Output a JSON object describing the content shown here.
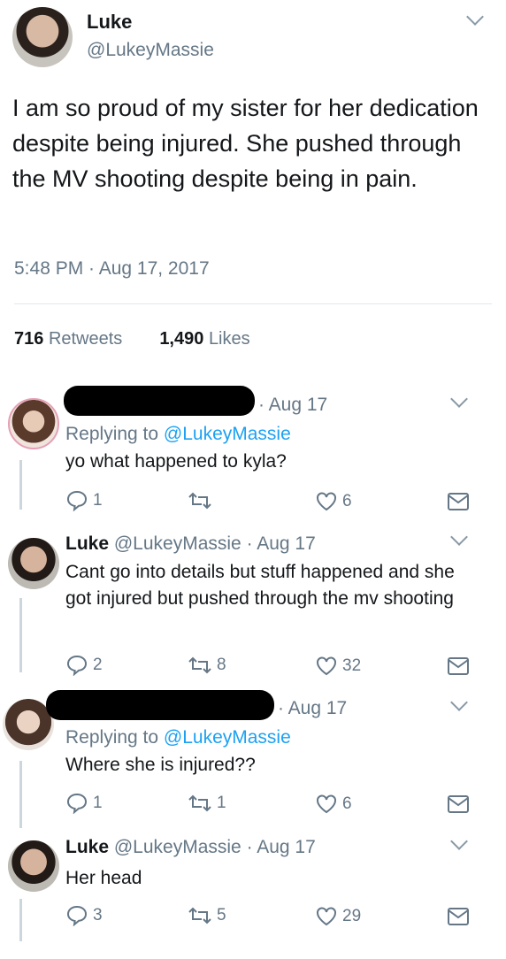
{
  "main_tweet": {
    "author_name": "Luke",
    "author_handle": "@LukeyMassie",
    "text": "I am so proud of my sister for her dedication despite being injured. She pushed through the MV shooting despite being in pain.",
    "timestamp": "5:48 PM · Aug 17, 2017",
    "retweets_count": "716",
    "retweets_label": "Retweets",
    "likes_count": "1,490",
    "likes_label": "Likes"
  },
  "replies": [
    {
      "date": "· Aug 17",
      "replying_prefix": "Replying to",
      "replying_handle": "@LukeyMassie",
      "text": "yo what happened to kyla?",
      "replies": "1",
      "retweets": "",
      "likes": "6"
    },
    {
      "name": "Luke",
      "handle_date": "@LukeyMassie · Aug 17",
      "text": "Cant go into details but stuff happened and she got injured but pushed through the mv shooting",
      "replies": "2",
      "retweets": "8",
      "likes": "32"
    },
    {
      "date": "· Aug 17",
      "replying_prefix": "Replying to",
      "replying_handle": "@LukeyMassie",
      "text": "Where she is injured??",
      "replies": "1",
      "retweets": "1",
      "likes": "6"
    },
    {
      "name": "Luke",
      "handle_date": "@LukeyMassie · Aug 17",
      "text": "Her head",
      "replies": "3",
      "retweets": "5",
      "likes": "29"
    }
  ]
}
